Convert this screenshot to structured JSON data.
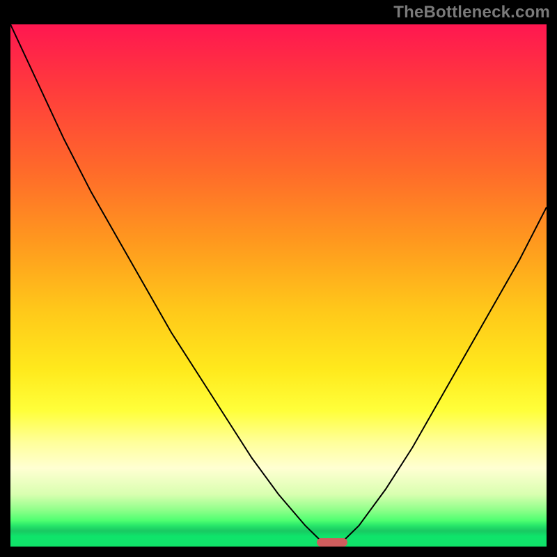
{
  "watermark": "TheBottleneck.com",
  "colors": {
    "curve": "#000000",
    "marker": "#cf5d5d",
    "background_frame": "#000000",
    "gradient_top": "#ff1750",
    "gradient_bottom": "#0fe168"
  },
  "chart_data": {
    "type": "line",
    "title": "",
    "xlabel": "",
    "ylabel": "",
    "xlim": [
      0,
      1
    ],
    "ylim": [
      0,
      1
    ],
    "x": [
      0.0,
      0.05,
      0.1,
      0.15,
      0.2,
      0.25,
      0.3,
      0.35,
      0.4,
      0.45,
      0.5,
      0.55,
      0.58,
      0.6,
      0.62,
      0.65,
      0.7,
      0.75,
      0.8,
      0.85,
      0.9,
      0.95,
      1.0
    ],
    "values": [
      1.0,
      0.89,
      0.78,
      0.68,
      0.59,
      0.5,
      0.41,
      0.33,
      0.25,
      0.17,
      0.1,
      0.04,
      0.01,
      0.0,
      0.01,
      0.04,
      0.11,
      0.19,
      0.28,
      0.37,
      0.46,
      0.55,
      0.65
    ],
    "marker": {
      "x_center": 0.6,
      "x_width": 0.06,
      "y": 0.0
    },
    "annotations": [],
    "legend": null,
    "grid": false
  }
}
